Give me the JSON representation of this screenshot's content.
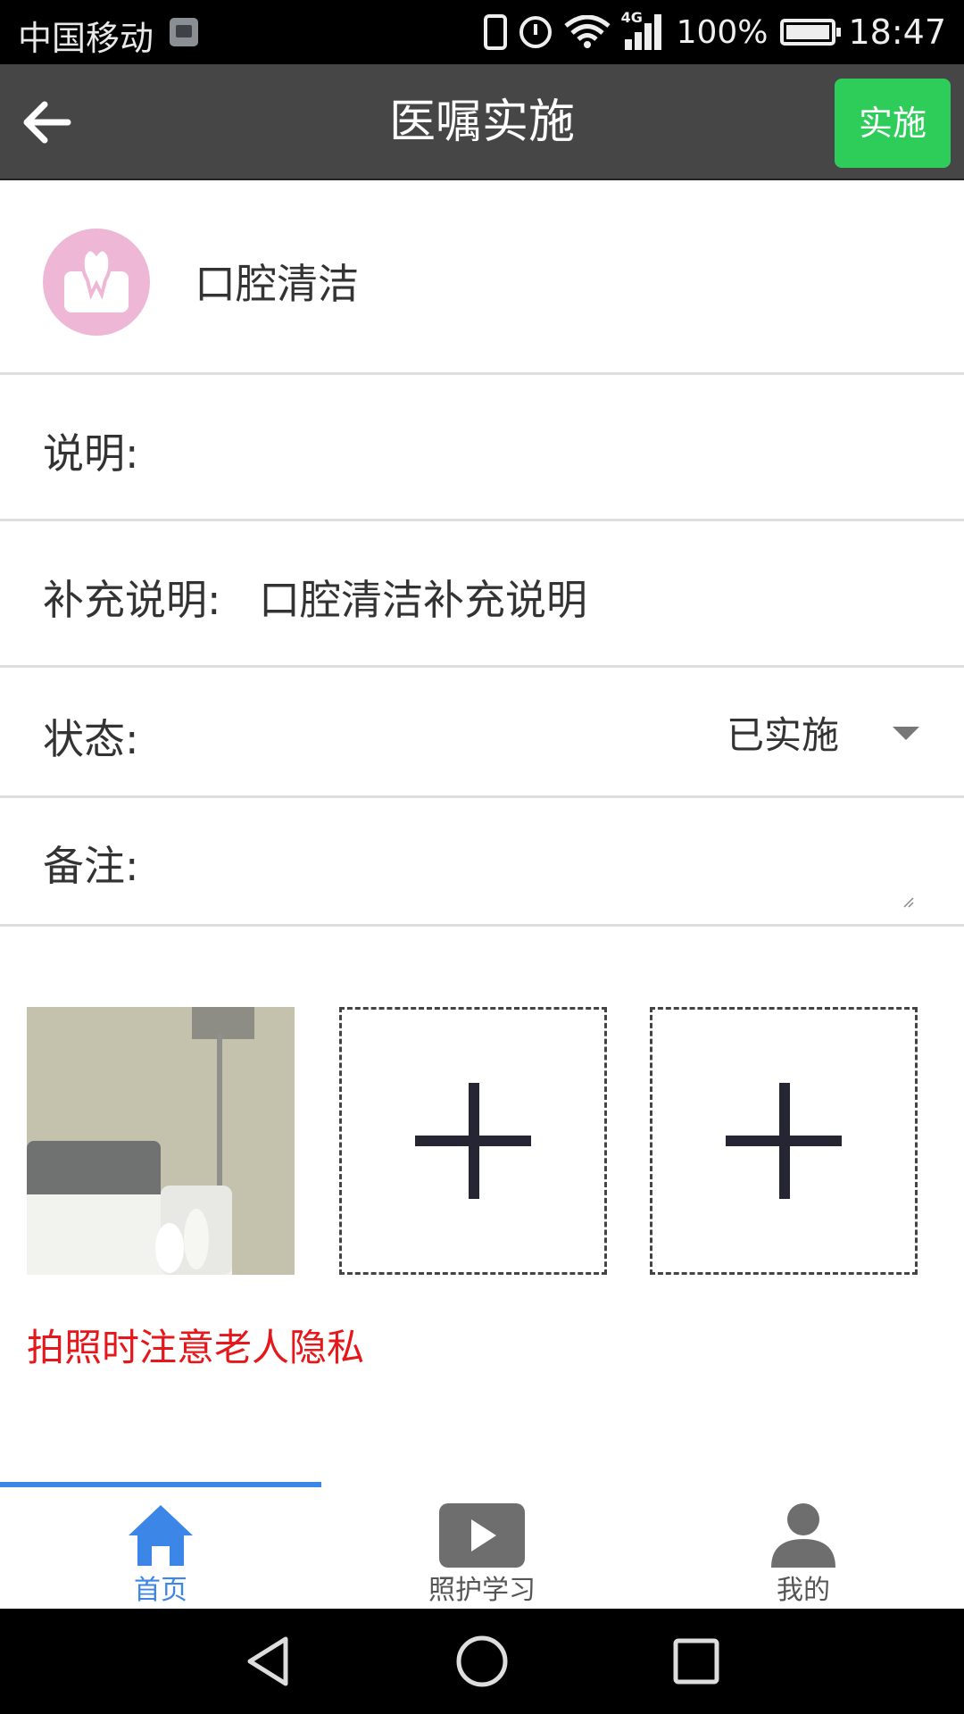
{
  "status_bar": {
    "carrier": "中国移动",
    "network": "4G",
    "battery": "100%",
    "time": "18:47"
  },
  "header": {
    "title": "医嘱实施",
    "action_label": "实施",
    "action_color": "#2ecc59",
    "background": "#464646"
  },
  "item": {
    "name": "口腔清洁",
    "icon": "tooth-icon",
    "icon_color": "#eeb7d6"
  },
  "form": {
    "description_label": "说明:",
    "supplement_label": "补充说明:",
    "supplement_value": "口腔清洁补充说明",
    "status_label": "状态:",
    "status_value": "已实施",
    "remark_label": "备注:"
  },
  "photos": {
    "add_icon": "plus-icon"
  },
  "privacy_note": "拍照时注意老人隐私",
  "privacy_color": "#e5171a",
  "tabs": [
    {
      "label": "首页",
      "icon": "home-icon",
      "active": true
    },
    {
      "label": "照护学习",
      "icon": "video-play-icon",
      "active": false
    },
    {
      "label": "我的",
      "icon": "user-icon",
      "active": false
    }
  ],
  "accent_color": "#3b86e6"
}
